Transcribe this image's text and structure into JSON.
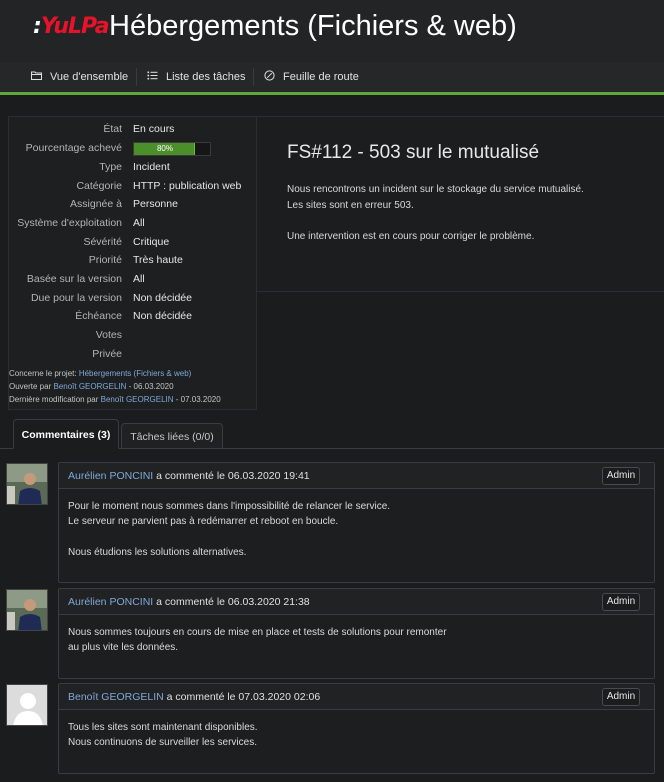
{
  "header": {
    "logo_colon": ":",
    "logo_text": "YuLPa",
    "title": "Hébergements (Fichiers & web)"
  },
  "nav": {
    "items": [
      {
        "label": "Vue d'ensemble",
        "icon": "folder-icon"
      },
      {
        "label": "Liste des tâches",
        "icon": "list-icon"
      },
      {
        "label": "Feuille de route",
        "icon": "roadmap-icon"
      }
    ]
  },
  "details": {
    "rows": [
      {
        "label": "État",
        "value": "En cours"
      },
      {
        "label": "Pourcentage achevé",
        "value": "80%"
      },
      {
        "label": "Type",
        "value": "Incident"
      },
      {
        "label": "Catégorie",
        "value": "HTTP : publication web"
      },
      {
        "label": "Assignée à",
        "value": "Personne"
      },
      {
        "label": "Système d'exploitation",
        "value": "All"
      },
      {
        "label": "Sévérité",
        "value": "Critique"
      },
      {
        "label": "Priorité",
        "value": "Très haute"
      },
      {
        "label": "Basée sur la version",
        "value": "All"
      },
      {
        "label": "Due pour la version",
        "value": "Non décidée"
      },
      {
        "label": "Échéance",
        "value": "Non décidée"
      },
      {
        "label": "Votes",
        "value": ""
      },
      {
        "label": "Privée",
        "value": ""
      }
    ],
    "progress_fraction": 0.8,
    "project_prefix": "Concerne le projet:",
    "project_link": "Hébergements (Fichiers & web)",
    "opened_prefix": "Ouverte par",
    "opened_by": "Benoît GEORGELIN",
    "opened_date": "- 06.03.2020",
    "modified_prefix": "Dernière modification par",
    "modified_by": "Benoît GEORGELIN",
    "modified_date": "- 07.03.2020"
  },
  "task": {
    "title": "FS#112 - 503 sur le mutualisé",
    "description": [
      "Nous rencontrons un incident sur le stockage du service mutualisé.",
      "Les sites sont en erreur 503.",
      "Une intervention est en cours pour corriger le problème."
    ]
  },
  "tabs": {
    "comments": "Commentaires (3)",
    "related": "Tâches liées (0/0)"
  },
  "comments": [
    {
      "author": "Aurélien PONCINI",
      "action": "a commenté le 06.03.2020 19:41",
      "admin": "Admin",
      "lines": [
        "Pour le moment nous sommes dans l'impossibilité de relancer le service.",
        "Le serveur ne parvient pas à redémarrer et reboot en boucle.",
        "Nous étudions les solutions alternatives."
      ]
    },
    {
      "author": "Aurélien PONCINI",
      "action": "a commenté le 06.03.2020 21:38",
      "admin": "Admin",
      "lines": [
        "Nous sommes toujours en cours de mise en place et tests de solutions pour remonter",
        "au plus vite les données."
      ]
    },
    {
      "author": "Benoît GEORGELIN",
      "action": "a commenté le 07.03.2020 02:06",
      "admin": "Admin",
      "lines": [
        "Tous les sites sont maintenant disponibles.",
        "Nous continuons de surveiller les services."
      ]
    }
  ],
  "colors": {
    "accent_green": "#5fa83a",
    "link_blue": "#7fa8d8",
    "logo_red": "#e8122a"
  }
}
